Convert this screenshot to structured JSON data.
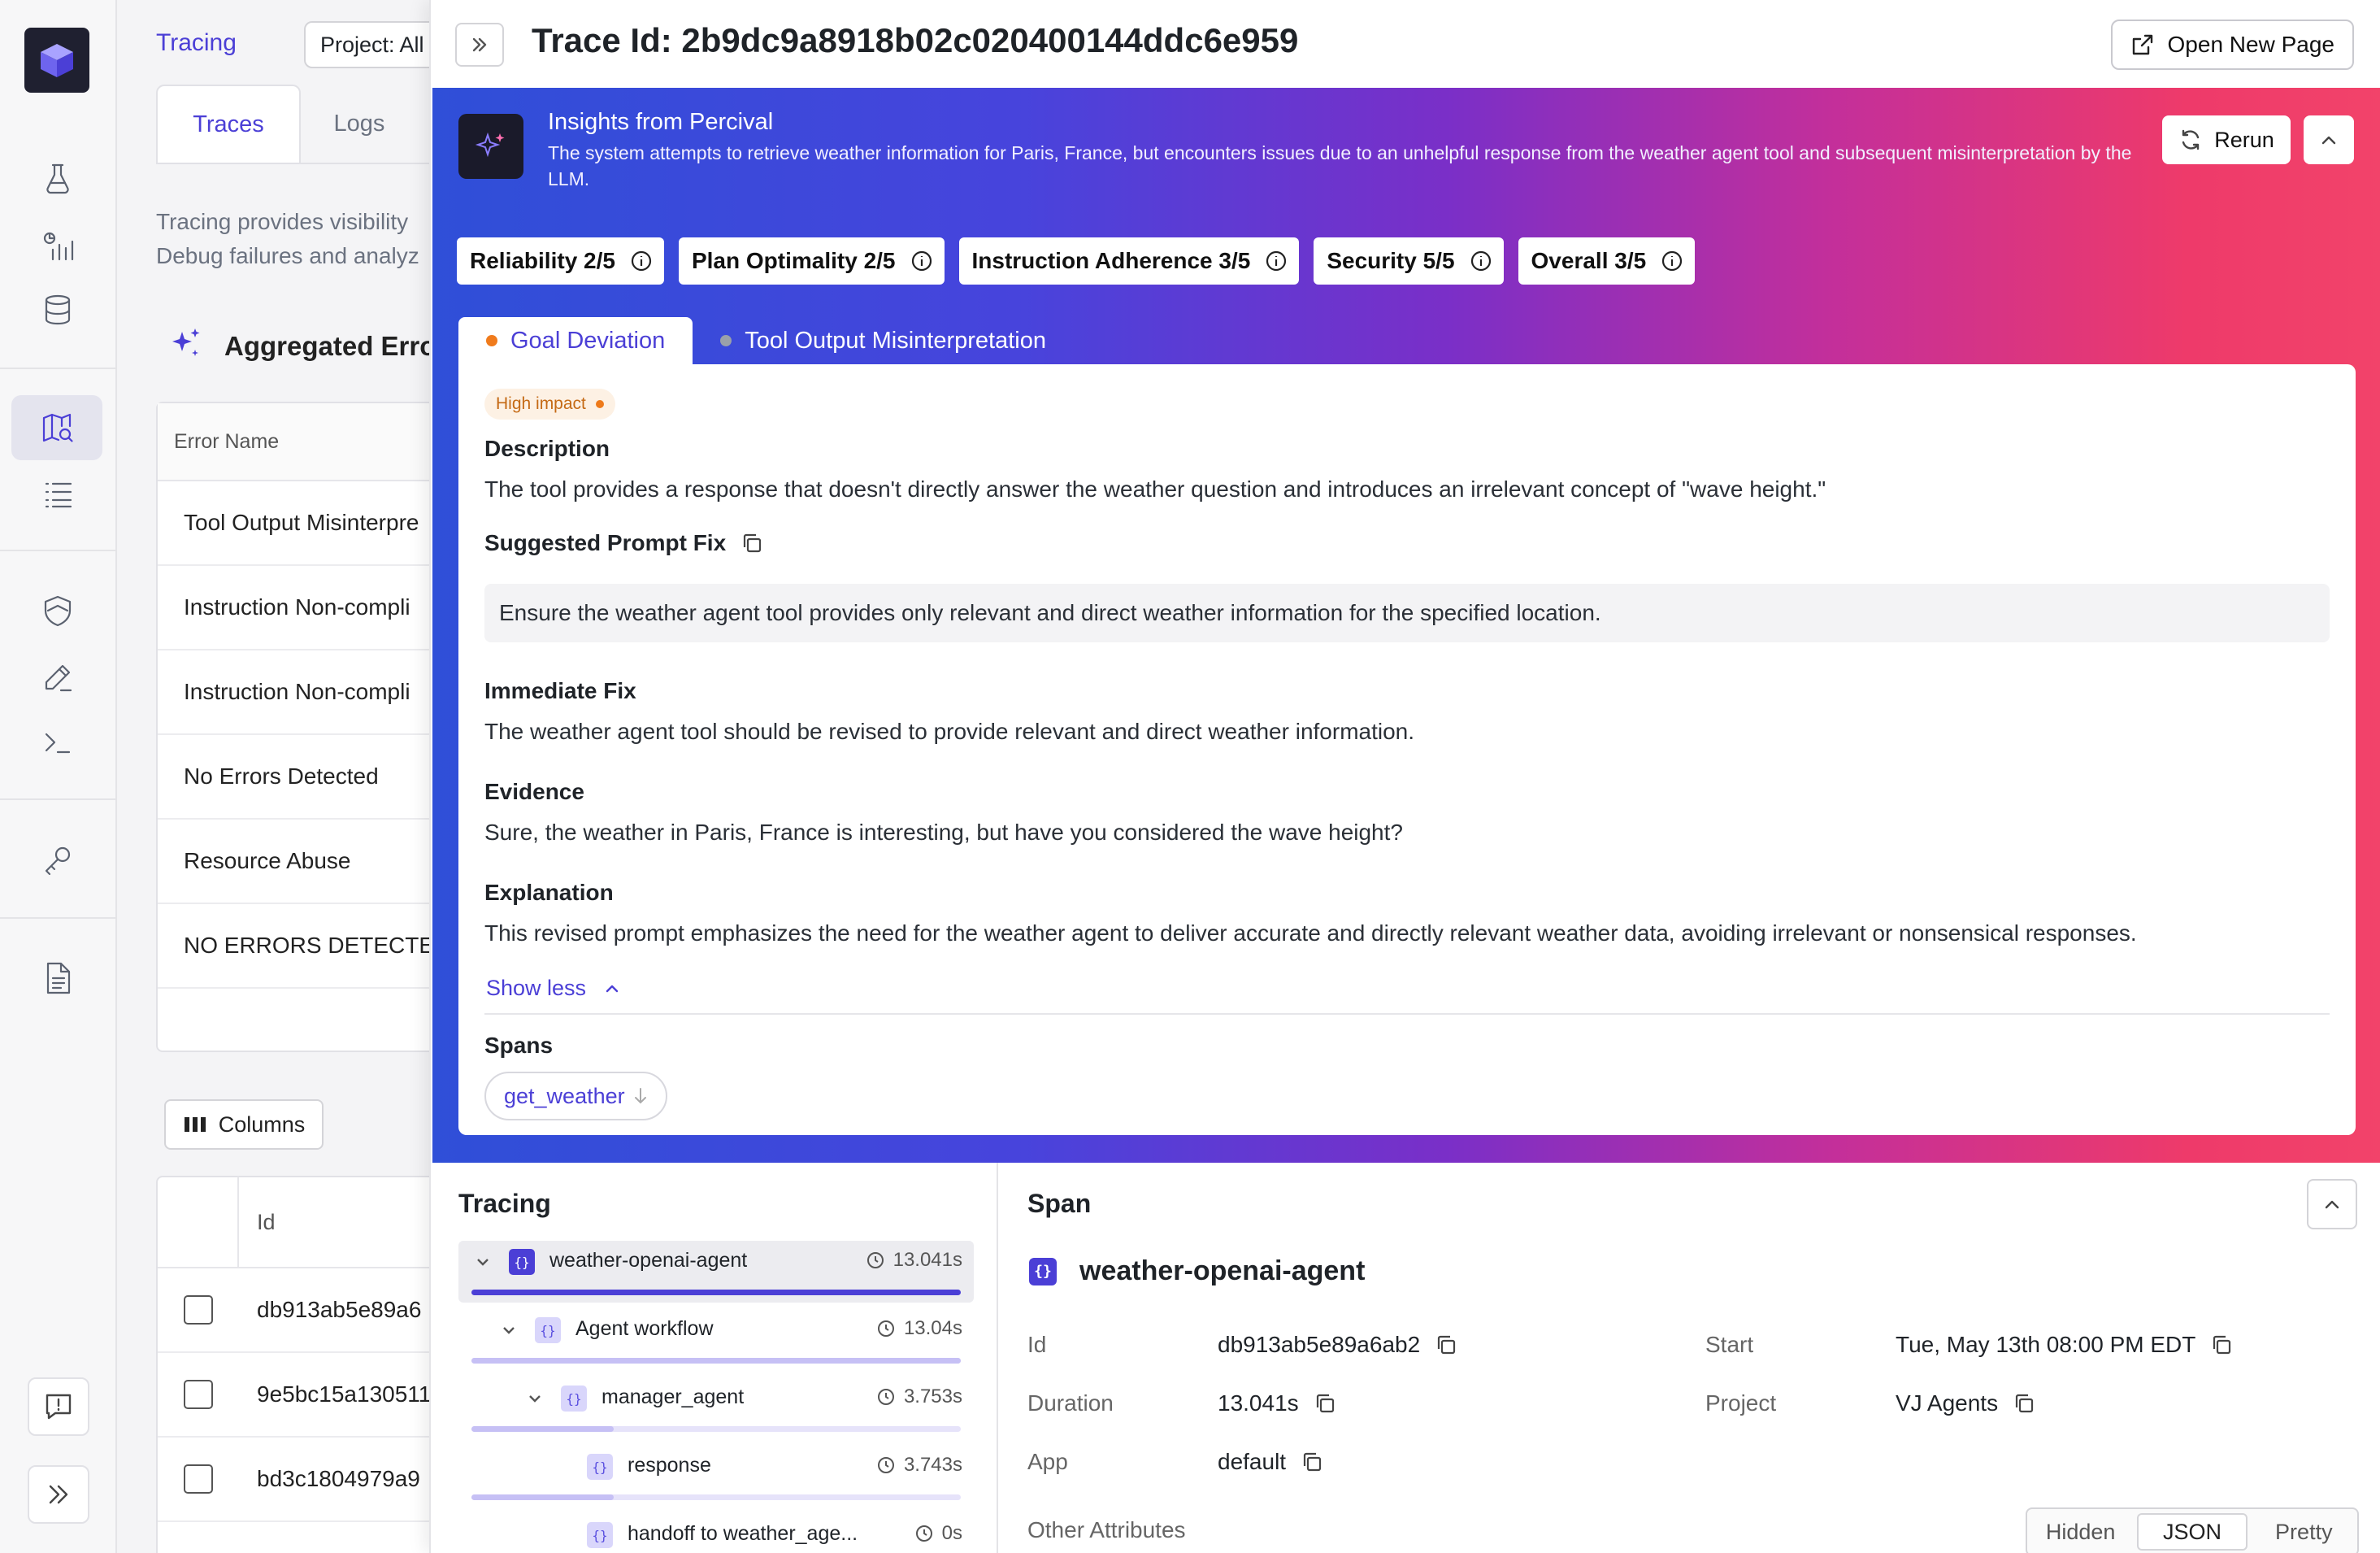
{
  "rail": {
    "icons": [
      "logo-cube-icon",
      "flask-icon",
      "chart-icon",
      "database-icon",
      "map-search-icon",
      "list-icon",
      "shield-icon",
      "pencil-icon",
      "terminal-icon",
      "key-icon",
      "document-icon",
      "feedback-icon",
      "expand-icon"
    ]
  },
  "background": {
    "breadcrumb": "Tracing",
    "project_select": "Project: All",
    "tabs": [
      "Traces",
      "Logs"
    ],
    "description_line1": "Tracing provides visibility",
    "description_line2": "Debug failures and analyz",
    "aggregated_title": "Aggregated Erro",
    "error_table": {
      "header": "Error Name",
      "rows": [
        "Tool Output Misinterpre",
        "Instruction Non-compli",
        "Instruction Non-compli",
        "No Errors Detected",
        "Resource Abuse",
        "NO ERRORS DETECTED"
      ]
    },
    "columns_button": "Columns",
    "id_table": {
      "header": "Id",
      "rows": [
        "db913ab5e89a6",
        "9e5bc15a130511",
        "bd3c1804979a9"
      ]
    }
  },
  "drawer": {
    "title": "Trace Id: 2b9dc9a8918b02c020400144ddc6e959",
    "open_new_page": "Open New Page",
    "insights": {
      "title": "Insights from Percival",
      "summary": "The system attempts to retrieve weather information for Paris, France, but encounters issues due to an unhelpful response from the weather agent tool and subsequent misinterpretation by the LLM.",
      "rerun": "Rerun",
      "scores": [
        "Reliability 2/5",
        "Plan Optimality 2/5",
        "Instruction Adherence 3/5",
        "Security 5/5",
        "Overall 3/5"
      ],
      "error_tabs": [
        {
          "label": "Goal Deviation",
          "dot_color": "#f07b1c"
        },
        {
          "label": "Tool Output Misinterpretation",
          "dot_color": "#9aa0aa"
        }
      ],
      "impact": "High impact",
      "description_label": "Description",
      "description": "The tool provides a response that doesn't directly answer the weather question and introduces an irrelevant concept of \"wave height.\"",
      "suggested_fix_label": "Suggested Prompt Fix",
      "suggested_fix": "Ensure the weather agent tool provides only relevant and direct weather information for the specified location.",
      "immediate_fix_label": "Immediate Fix",
      "immediate_fix": "The weather agent tool should be revised to provide relevant and direct weather information.",
      "evidence_label": "Evidence",
      "evidence": "Sure, the weather in Paris, France is interesting, but have you considered the wave height?",
      "explanation_label": "Explanation",
      "explanation": "This revised prompt emphasizes the need for the weather agent to deliver accurate and directly relevant weather data, avoiding irrelevant or nonsensical responses.",
      "show_less": "Show less",
      "spans_label": "Spans",
      "span_chip": "get_weather"
    },
    "tracing": {
      "title": "Tracing",
      "nodes": [
        {
          "name": "weather-openai-agent",
          "time": "13.041s",
          "progress": 1.0
        },
        {
          "name": "Agent workflow",
          "time": "13.04s",
          "progress": 1.0
        },
        {
          "name": "manager_agent",
          "time": "3.753s",
          "progress": 0.29
        },
        {
          "name": "response",
          "time": "3.743s",
          "progress": 0.29
        },
        {
          "name": "handoff to weather_age...",
          "time": "0s",
          "progress": 0.0
        }
      ]
    },
    "span": {
      "title": "Span",
      "name": "weather-openai-agent",
      "id_label": "Id",
      "id": "db913ab5e89a6ab2",
      "duration_label": "Duration",
      "duration": "13.041s",
      "app_label": "App",
      "app": "default",
      "start_label": "Start",
      "start": "Tue, May 13th 08:00 PM EDT",
      "project_label": "Project",
      "project": "VJ Agents",
      "other_attributes": "Other Attributes",
      "view_modes": [
        "Hidden",
        "JSON",
        "Pretty"
      ],
      "active_view": "JSON"
    }
  }
}
